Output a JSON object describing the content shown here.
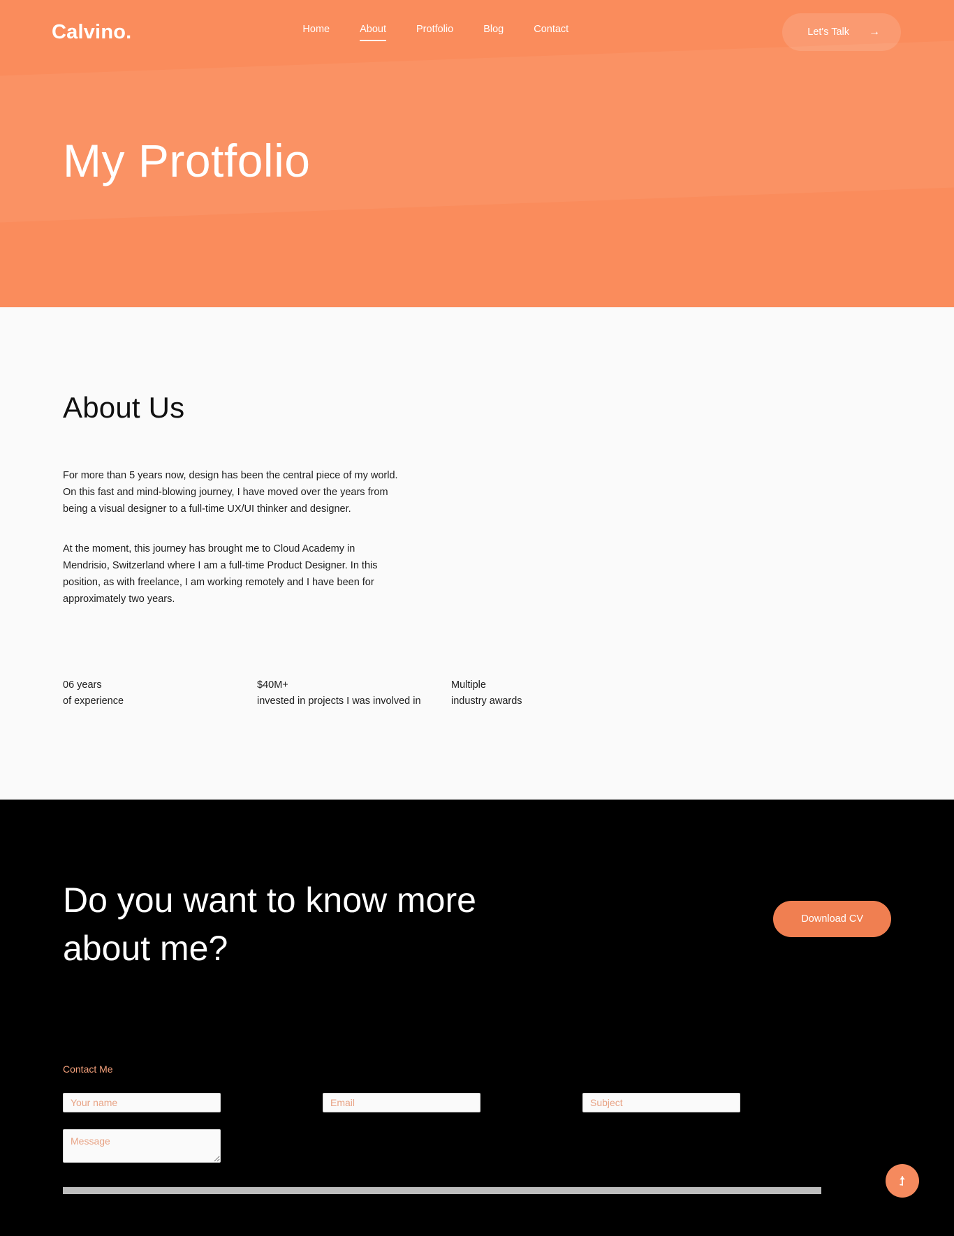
{
  "header": {
    "brand": "Calvino.",
    "nav": [
      {
        "label": "Home",
        "active": false
      },
      {
        "label": "About",
        "active": true
      },
      {
        "label": "Protfolio",
        "active": false
      },
      {
        "label": "Blog",
        "active": false
      },
      {
        "label": "Contact",
        "active": false
      }
    ],
    "cta_label": "Let's Talk",
    "cta_arrow": "→"
  },
  "hero": {
    "title": "My Protfolio"
  },
  "about": {
    "title": "About Us",
    "paragraphs": [
      "For more than 5 years now, design has been the central piece of my world. On this fast and mind-blowing journey, I have moved over the years from being a visual designer to a full-time UX/UI thinker and designer.",
      "At the moment, this journey has brought me to Cloud Academy in Mendrisio, Switzerland where I am a full-time Product Designer. In this position, as with freelance, I am working remotely and I have been for approximately two years."
    ],
    "stats": [
      {
        "value": "06 years",
        "label": "of experience"
      },
      {
        "value": "$40M+",
        "label": "invested in projects I was involved in"
      },
      {
        "value": "Multiple",
        "label": "industry awards"
      }
    ]
  },
  "cta_section": {
    "heading": "Do you want to know more about me?",
    "download_label": "Download CV"
  },
  "contact": {
    "label": "Contact Me",
    "fields": {
      "name": {
        "placeholder": "Your name",
        "value": ""
      },
      "email": {
        "placeholder": "Email",
        "value": ""
      },
      "subject": {
        "placeholder": "Subject",
        "value": ""
      },
      "message": {
        "placeholder": "Message",
        "value": ""
      }
    }
  },
  "scroll_top": {
    "icon": "arrow-up-icon"
  },
  "colors": {
    "brand_orange": "#FA8C5C",
    "button_orange": "#F07F51",
    "dark": "#000000",
    "light_bg": "#FAFAFA",
    "placeholder_orange": "#E8A385"
  }
}
